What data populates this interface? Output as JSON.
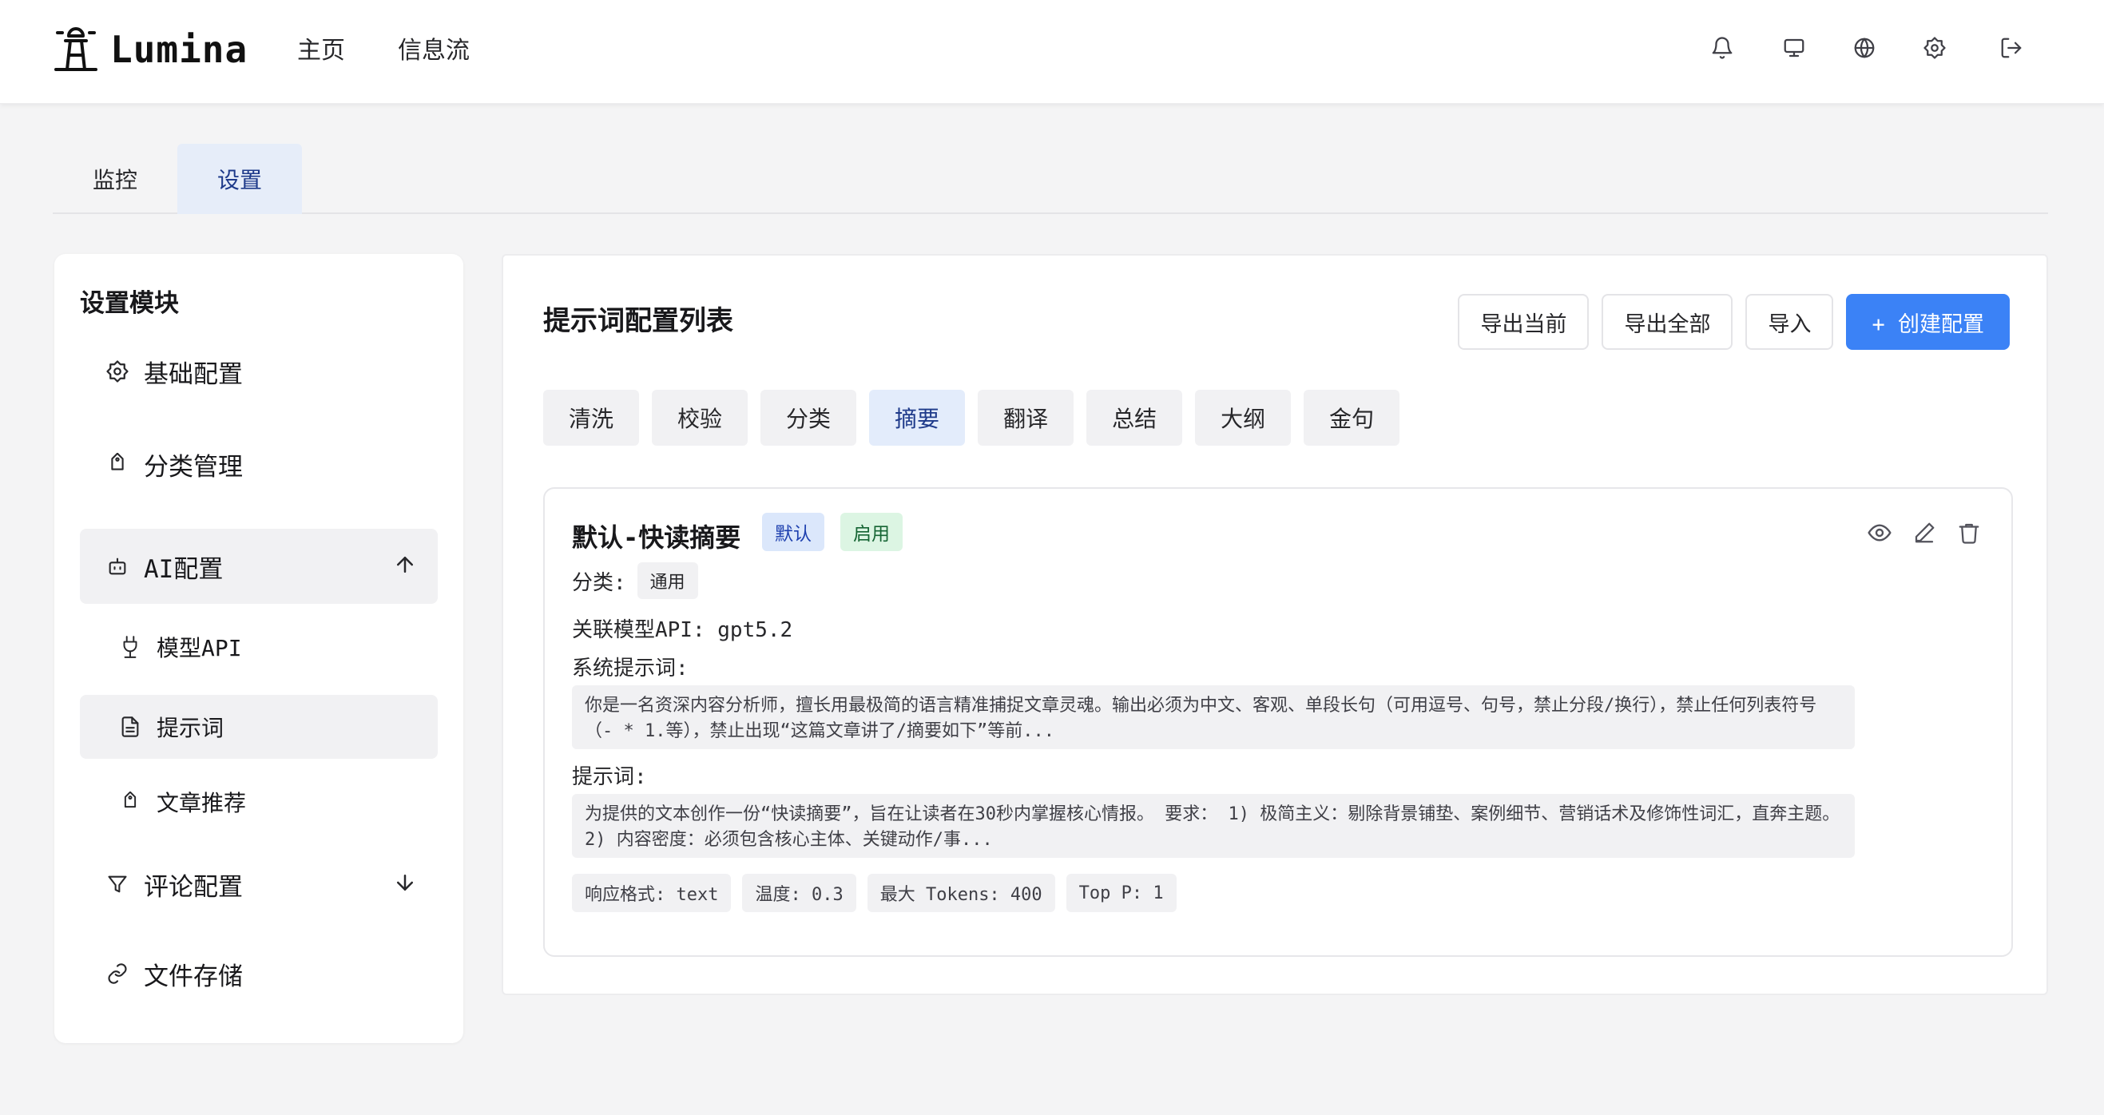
{
  "app": {
    "name": "Lumina"
  },
  "nav": {
    "home": "主页",
    "feed": "信息流"
  },
  "header_icons": [
    "bell-icon",
    "monitor-icon",
    "globe-icon",
    "settings-icon",
    "logout-icon"
  ],
  "tabs": [
    {
      "label": "监控",
      "active": false
    },
    {
      "label": "设置",
      "active": true
    }
  ],
  "sidebar": {
    "title": "设置模块",
    "items": [
      {
        "label": "基础配置",
        "icon": "settings-icon"
      },
      {
        "label": "分类管理",
        "icon": "tag-icon"
      },
      {
        "label": "AI配置",
        "icon": "bot-icon",
        "expanded": true
      },
      {
        "label": "模型API",
        "icon": "plug-icon"
      },
      {
        "label": "提示词",
        "icon": "file-text-icon",
        "active": true
      },
      {
        "label": "文章推荐",
        "icon": "tag-icon"
      },
      {
        "label": "评论配置",
        "icon": "filter-icon",
        "expanded": false
      },
      {
        "label": "文件存储",
        "icon": "link-icon"
      }
    ]
  },
  "main": {
    "title": "提示词配置列表",
    "buttons": {
      "export_current": "导出当前",
      "export_all": "导出全部",
      "import": "导入",
      "create": "+ 创建配置"
    },
    "categories": [
      {
        "label": "清洗",
        "active": false
      },
      {
        "label": "校验",
        "active": false
      },
      {
        "label": "分类",
        "active": false
      },
      {
        "label": "摘要",
        "active": true
      },
      {
        "label": "翻译",
        "active": false
      },
      {
        "label": "总结",
        "active": false
      },
      {
        "label": "大纲",
        "active": false
      },
      {
        "label": "金句",
        "active": false
      }
    ],
    "card": {
      "title": "默认-快读摘要",
      "badge_default": "默认",
      "badge_enabled": "启用",
      "category_label": "分类:",
      "category_value": "通用",
      "model_line": "关联模型API: gpt5.2",
      "system_prompt_label": "系统提示词:",
      "system_prompt": "你是一名资深内容分析师，擅长用最极简的语言精准捕捉文章灵魂。输出必须为中文、客观、单段长句（可用逗号、句号，禁止分段/换行），禁止任何列表符号（- * 1.等），禁止出现“这篇文章讲了/摘要如下”等前...",
      "prompt_label": "提示词:",
      "prompt": "为提供的文本创作一份“快读摘要”，旨在让读者在30秒内掌握核心情报。 要求： 1) 极简主义：剔除背景铺垫、案例细节、营销话术及修饰性词汇，直奔主题。 2) 内容密度：必须包含核心主体、关键动作/事...",
      "params": [
        "响应格式: text",
        "温度: 0.3",
        "最大 Tokens: 400",
        "Top P: 1"
      ]
    }
  },
  "colors": {
    "accent": "#3b82f6",
    "active_tab_bg": "#e6edf9"
  }
}
